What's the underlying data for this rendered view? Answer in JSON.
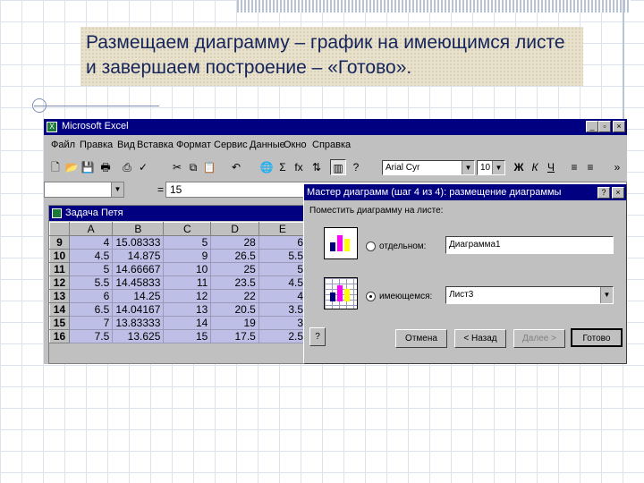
{
  "slide": {
    "caption": "Размещаем диаграмму – график на имеющимся листе и завершаем построение – «Готово»."
  },
  "excel": {
    "window_title": "Microsoft Excel",
    "menu": [
      "Файл",
      "Правка",
      "Вид",
      "Вставка",
      "Формат",
      "Сервис",
      "Данные",
      "Окно",
      "Справка"
    ],
    "toolbar": {
      "font_name": "Arial Cyr",
      "font_size": "10",
      "bold": "Ж",
      "italic": "К",
      "underline": "Ч",
      "sigma": "Σ",
      "fx": "fx"
    },
    "formula_bar": {
      "equals": "=",
      "value": "15"
    },
    "worksheet": {
      "title": "Задача Петя",
      "columns": [
        "A",
        "B",
        "C",
        "D",
        "E"
      ],
      "rows": [
        {
          "n": "9",
          "cells": [
            "4",
            "15.08333",
            "5",
            "28",
            "6"
          ]
        },
        {
          "n": "10",
          "cells": [
            "4.5",
            "14.875",
            "9",
            "26.5",
            "5.5"
          ]
        },
        {
          "n": "11",
          "cells": [
            "5",
            "14.66667",
            "10",
            "25",
            "5"
          ]
        },
        {
          "n": "12",
          "cells": [
            "5.5",
            "14.45833",
            "11",
            "23.5",
            "4.5"
          ]
        },
        {
          "n": "13",
          "cells": [
            "6",
            "14.25",
            "12",
            "22",
            "4"
          ]
        },
        {
          "n": "14",
          "cells": [
            "6.5",
            "14.04167",
            "13",
            "20.5",
            "3.5"
          ]
        },
        {
          "n": "15",
          "cells": [
            "7",
            "13.83333",
            "14",
            "19",
            "3"
          ]
        },
        {
          "n": "16",
          "cells": [
            "7.5",
            "13.625",
            "15",
            "17.5",
            "2.5"
          ]
        }
      ]
    },
    "wizard": {
      "title": "Мастер диаграмм (шаг 4 из 4): размещение диаграммы",
      "help": "?",
      "close": "×",
      "prompt": "Поместить диаграмму на листе:",
      "option_separate": "отдельном:",
      "option_existing": "имеющемся:",
      "separate_value": "Диаграмма1",
      "existing_value": "Лист3",
      "buttons": {
        "cancel": "Отмена",
        "back": "< Назад",
        "next": "Далее >",
        "finish": "Готово"
      }
    }
  }
}
